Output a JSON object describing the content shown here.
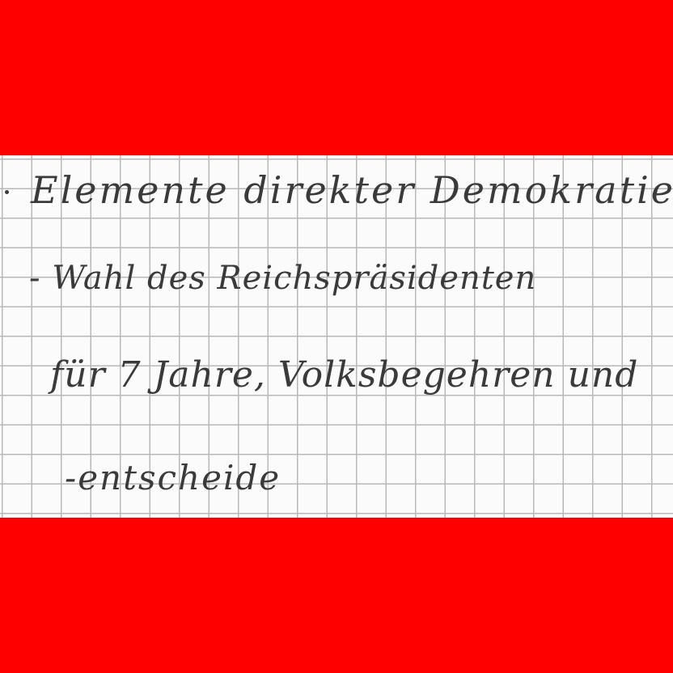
{
  "colors": {
    "band": "#ff0000",
    "paper": "#fbfbfb",
    "grid": "#b8b8b8",
    "ink": "#3a3a3a"
  },
  "note": {
    "lines": [
      "Elemente direkter Demokratie",
      "- Wahl des Reichspräsidenten",
      "für 7 Jahre, Volksbegehren und",
      "-entscheide"
    ]
  }
}
